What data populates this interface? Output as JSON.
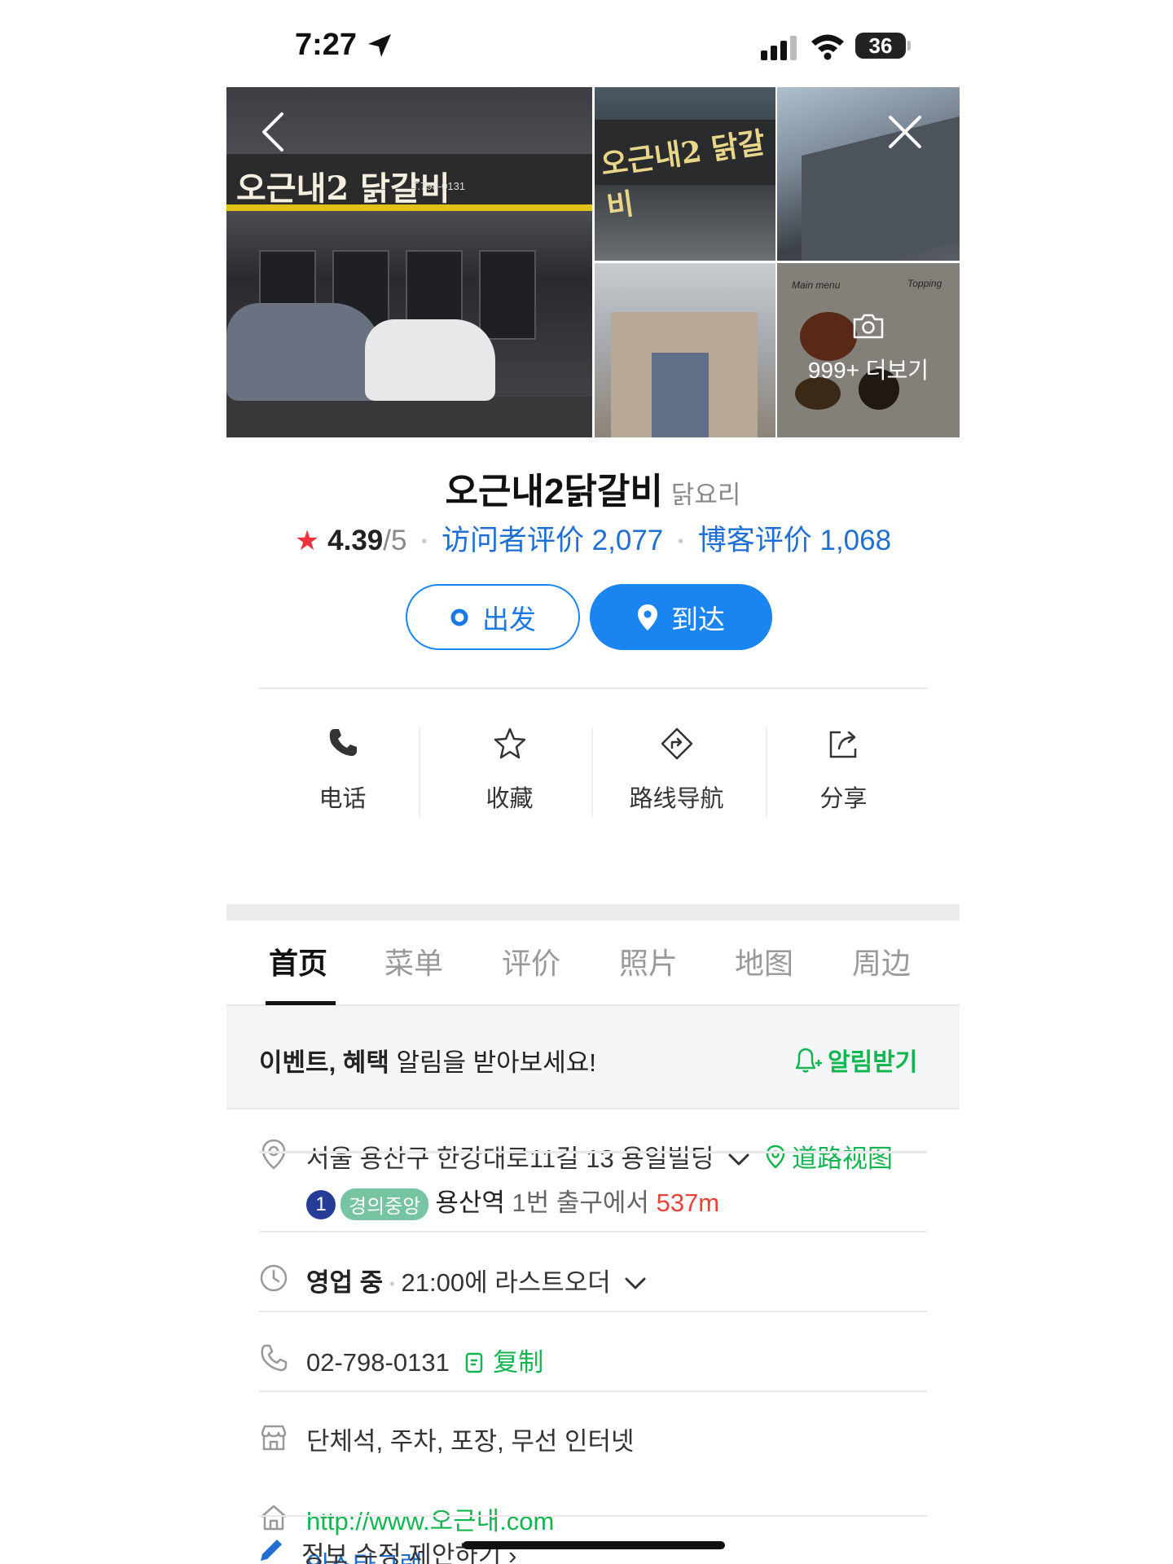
{
  "status": {
    "time": "7:27",
    "battery": "36"
  },
  "place": {
    "name": "오근내2닭갈비",
    "category": "닭요리",
    "rating": "4.39",
    "rating_max": "/5",
    "visitor_reviews": "访问者评价 2,077",
    "blog_reviews": "博客评价 1,068"
  },
  "photos": {
    "sign_main": "오근내2 닭갈비",
    "sign_tel": "T.798-0131",
    "sign_b": "오근내2 닭갈비",
    "menu_label": "Main menu",
    "topping_label": "Topping",
    "more": "999+ 더보기"
  },
  "buttons": {
    "depart": "出发",
    "arrive": "到达"
  },
  "actions": [
    {
      "label": "电话",
      "icon": "phone-icon"
    },
    {
      "label": "收藏",
      "icon": "star-icon"
    },
    {
      "label": "路线导航",
      "icon": "route-icon"
    },
    {
      "label": "分享",
      "icon": "share-icon"
    }
  ],
  "tabs": [
    "首页",
    "菜单",
    "评价",
    "照片",
    "地图",
    "周边"
  ],
  "active_tab": "首页",
  "notice": {
    "bold1": "이벤트",
    "sep": ", ",
    "bold2": "혜택",
    "rest": " 알림을 받아보세요!",
    "button": "알림받기"
  },
  "info": {
    "address": "서울 용산구 한강대로11길 13 용일빌딩",
    "street_view": "道路视图",
    "subway_line_num": "1",
    "subway_line_name": "경의중앙",
    "station": "용산역",
    "exit": " 1번 출구에서 ",
    "distance": "537m",
    "open_status": "영업 중",
    "last_order": "21:00에 라스트오더",
    "phone": "02-798-0131",
    "copy": "复制",
    "facilities": "단체석, 주차, 포장, 무선 인터넷",
    "website": "http://www.오근내.com",
    "instagram": "인스타그램",
    "suggest_edit": "정보 수정 제안하기"
  },
  "colors": {
    "accent_blue": "#1a84f0",
    "green": "#13b551",
    "star_red": "#f0323c",
    "distance_red": "#e8423b"
  }
}
